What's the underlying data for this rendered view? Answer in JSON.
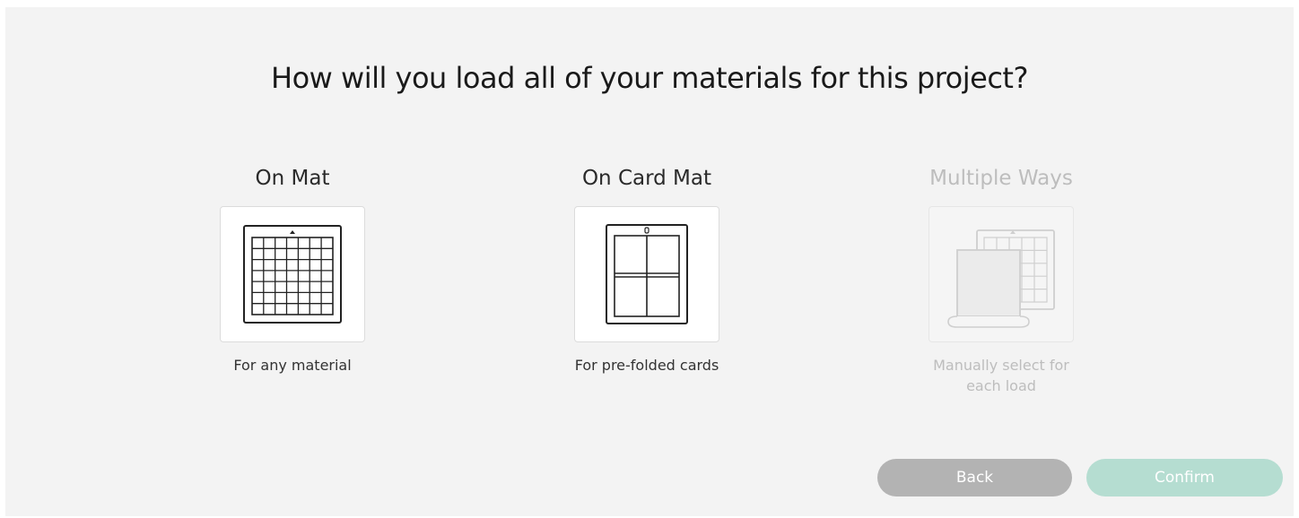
{
  "dialog": {
    "title": "How will you load all of your materials for this project?"
  },
  "options": [
    {
      "title": "On Mat",
      "description": "For any material",
      "icon": "cutting-mat-icon",
      "enabled": true
    },
    {
      "title": "On Card Mat",
      "description": "For pre-folded cards",
      "icon": "card-mat-icon",
      "enabled": true
    },
    {
      "title": "Multiple Ways",
      "description": "Manually select for each load",
      "icon": "multiple-ways-icon",
      "enabled": false
    }
  ],
  "buttons": {
    "back_label": "Back",
    "confirm_label": "Confirm",
    "confirm_enabled": false
  },
  "colors": {
    "background": "#f3f3f3",
    "back_button": "#b3b3b3",
    "confirm_button": "#b5ddd1",
    "disabled_text": "#bdbdbd"
  }
}
